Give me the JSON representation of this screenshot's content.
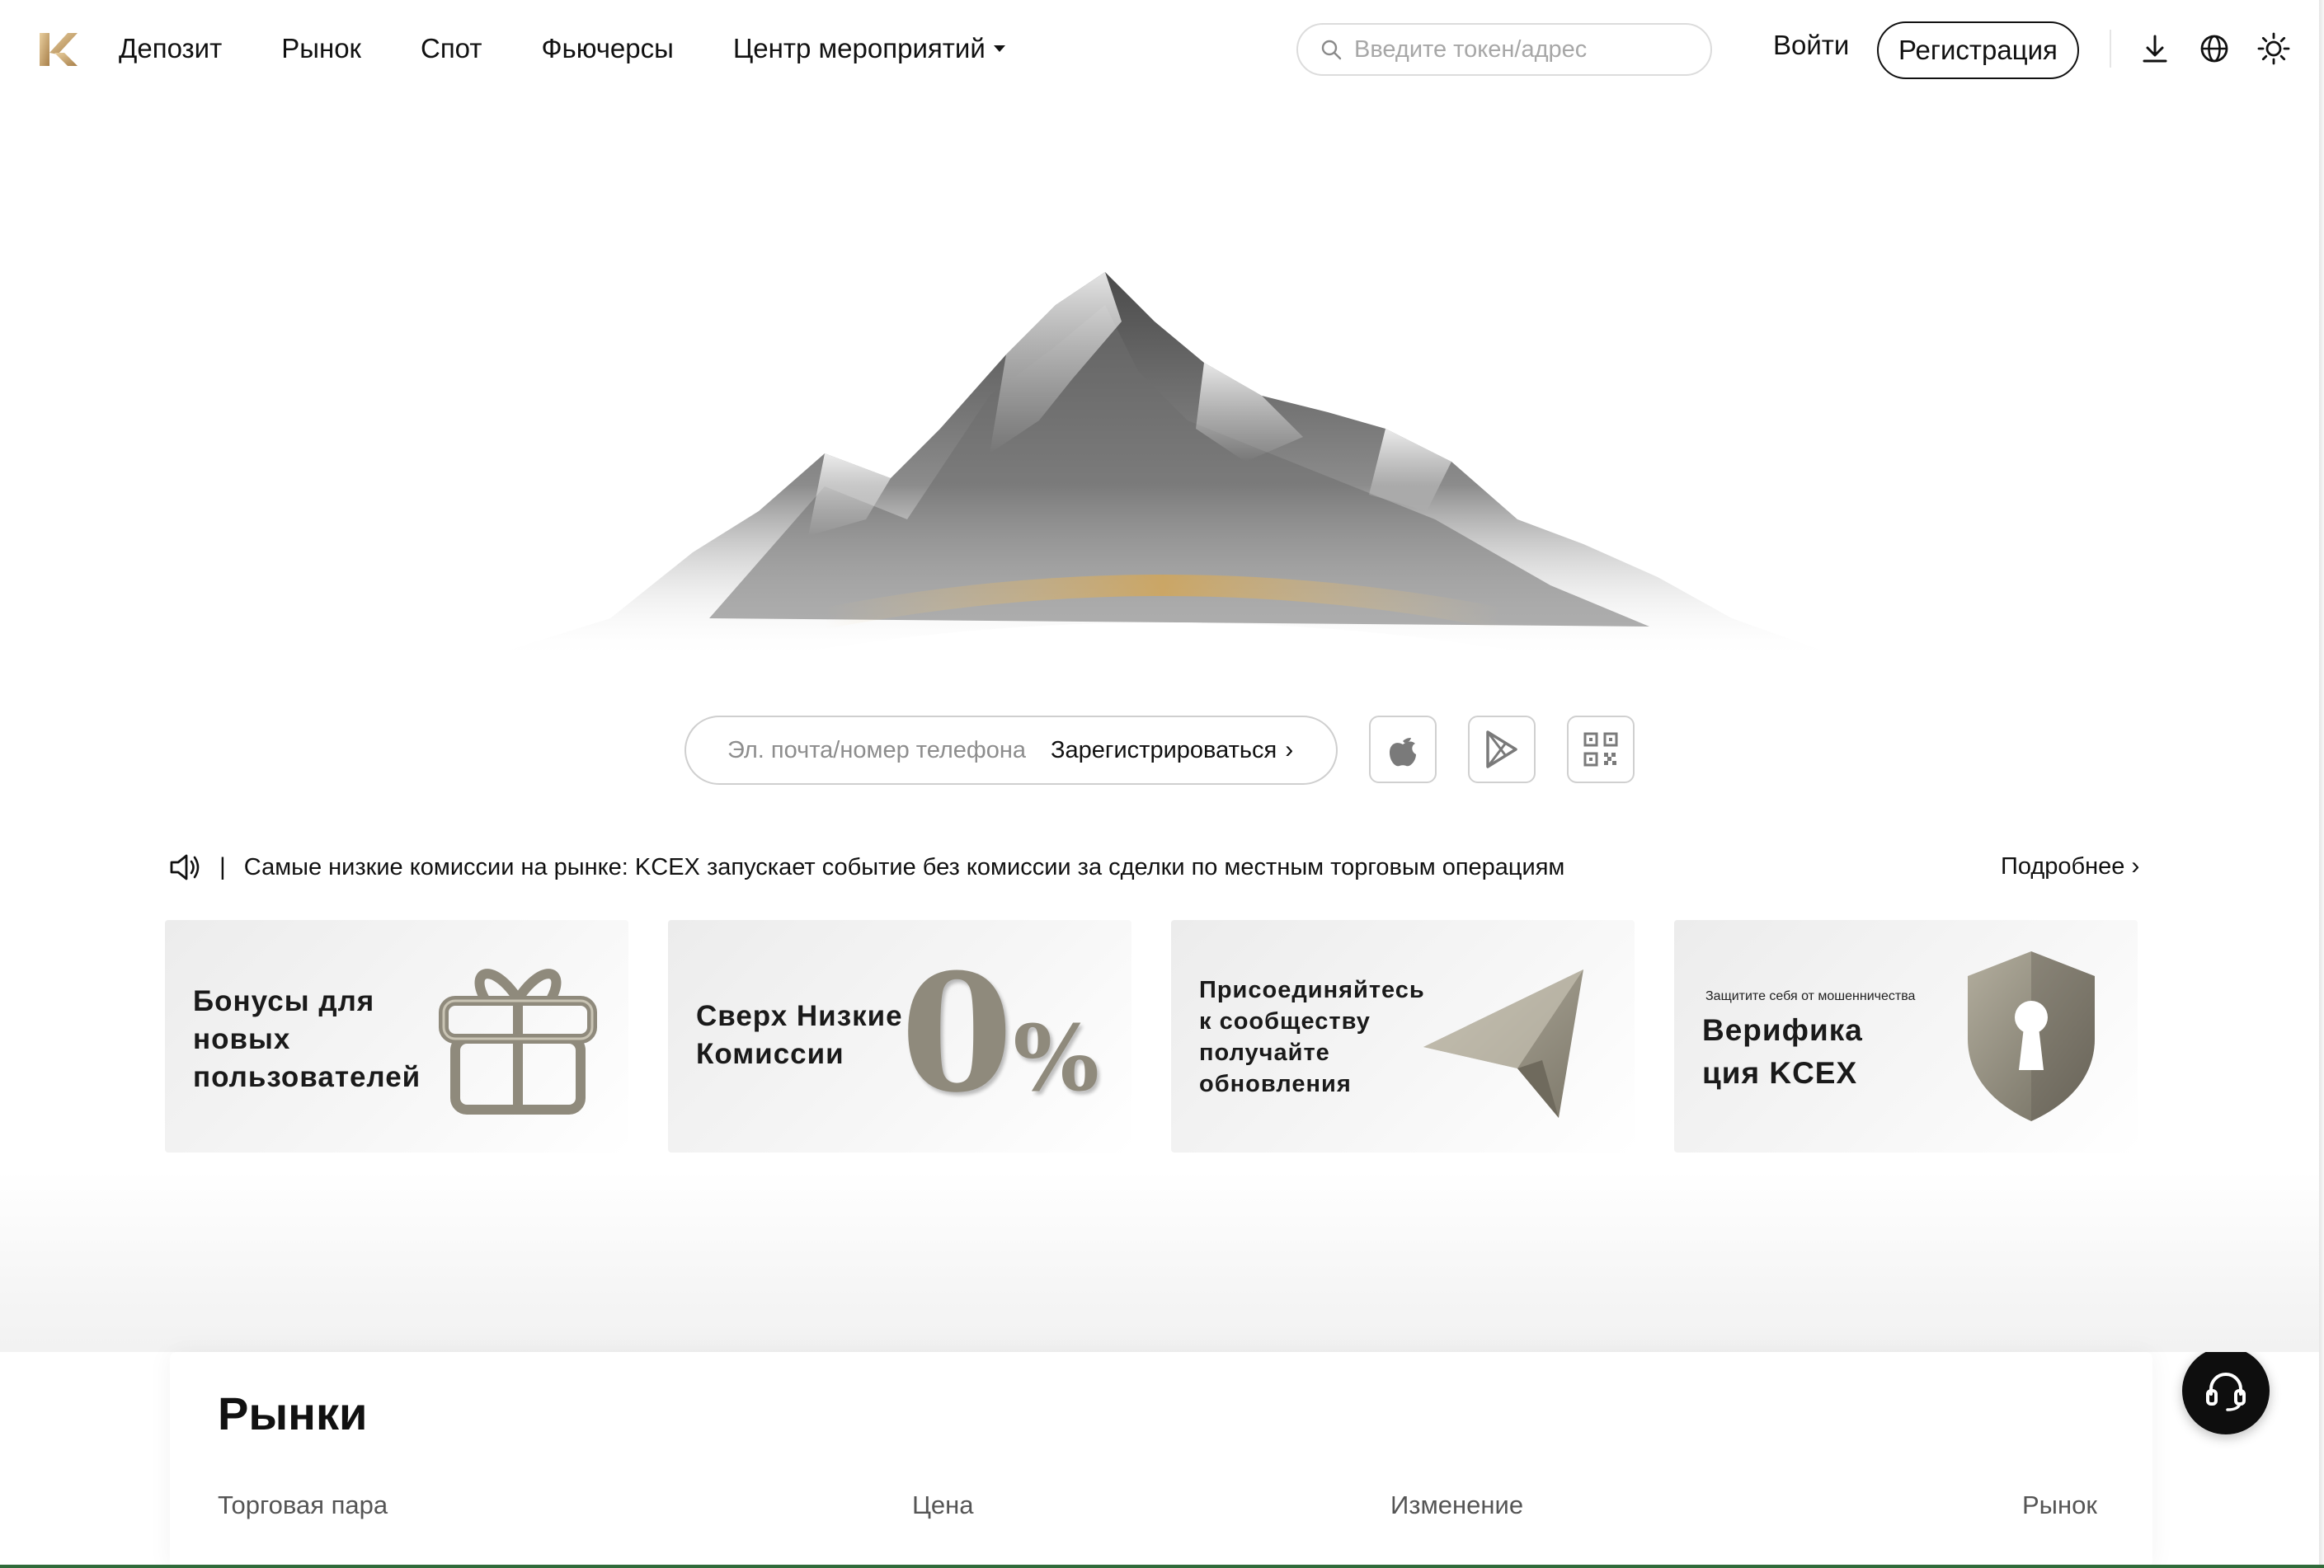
{
  "nav": {
    "items": [
      "Депозит",
      "Рынок",
      "Спот",
      "Фьючерсы",
      "Центр мероприятий"
    ]
  },
  "search": {
    "placeholder": "Введите токен/адрес"
  },
  "auth": {
    "login_label": "Войти",
    "register_label": "Регистрация"
  },
  "header_icons": [
    "download-icon",
    "globe-icon",
    "sun-icon"
  ],
  "hero": {
    "input_placeholder": "Эл. почта/номер телефона",
    "signup_label": "Зарегистрироваться",
    "app_icons": [
      "apple-icon",
      "google-play-icon",
      "qr-code-icon"
    ]
  },
  "announcement": {
    "text": "Самые низкие комиссии на рынке: KCEX запускает событие без комиссии за сделки по местным торговым операциям",
    "more_label": "Подробнее"
  },
  "cards": [
    {
      "title_lines": [
        "Бонусы для",
        "новых",
        "пользователей"
      ],
      "icon": "gift-icon"
    },
    {
      "title_lines": [
        "Сверх Низкие",
        "Комиссии"
      ],
      "art_text": "0%"
    },
    {
      "title_lines": [
        "Присоединяйтесь",
        "к сообществу",
        "получайте",
        "обновления"
      ],
      "icon": "telegram-icon"
    },
    {
      "small_text": "Защитите себя от мошенничества",
      "title_lines": [
        "Верифика",
        "ция KCEX"
      ],
      "icon": "shield-lock-icon"
    }
  ],
  "floating": [
    "download-icon",
    "headset-icon"
  ],
  "markets": {
    "title": "Рынки",
    "columns": [
      "Торговая пара",
      "Цена",
      "Изменение",
      "Рынок"
    ]
  },
  "colors": {
    "accent_gold": "#c8a46a",
    "card_metal": "#8f8a7c",
    "dark": "#0e0e0e"
  }
}
